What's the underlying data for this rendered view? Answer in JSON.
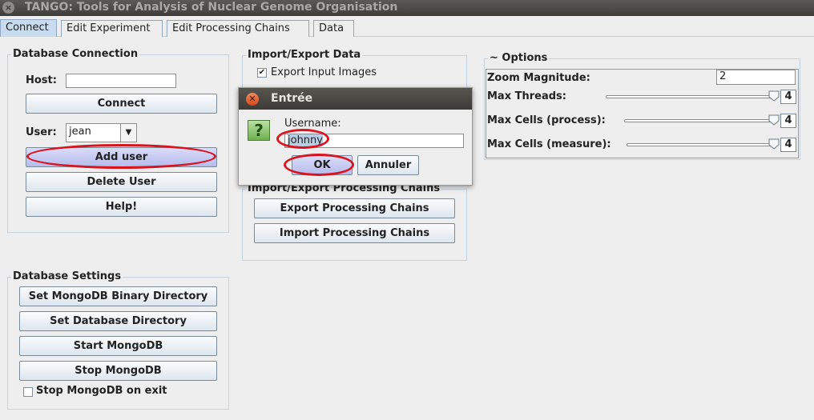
{
  "window": {
    "title": "TANGO: Tools for Analysis of Nuclear Genome Organisation",
    "close_glyph": "×"
  },
  "tabs": [
    {
      "label": "Connect",
      "active": true
    },
    {
      "label": "Edit Experiment"
    },
    {
      "label": "Edit Processing Chains"
    },
    {
      "label": "Data"
    }
  ],
  "db_connection": {
    "title": "Database Connection",
    "host_label": "Host:",
    "host_value": "",
    "connect_label": "Connect",
    "user_label": "User:",
    "user_value": "jean",
    "add_user_label": "Add user",
    "delete_user_label": "Delete User",
    "help_label": "Help!"
  },
  "import_export": {
    "title": "Import/Export Data",
    "export_images_label": "Export Input Images",
    "export_images_checked": true
  },
  "processing_chains": {
    "title": "Import/Export Processing Chains",
    "export_label": "Export Processing Chains",
    "import_label": "Import Processing Chains"
  },
  "db_settings": {
    "title": "Database Settings",
    "binary_dir_label": "Set MongoDB Binary Directory",
    "db_dir_label": "Set Database Directory",
    "start_label": "Start MongoDB",
    "stop_label": "Stop MongoDB",
    "stop_on_exit_label": "Stop MongoDB on exit",
    "stop_on_exit_checked": false
  },
  "options": {
    "title": "~ Options",
    "zoom_label": "Zoom Magnitude:",
    "zoom_value": "2",
    "threads_label": "Max Threads:",
    "threads_value": "4",
    "cells_process_label": "Max Cells (process):",
    "cells_process_value": "4",
    "cells_measure_label": "Max Cells (measure):",
    "cells_measure_value": "4"
  },
  "dialog": {
    "title": "Entrée",
    "icon_glyph": "?",
    "prompt_label": "Username:",
    "input_value": "johnny",
    "ok_label": "OK",
    "cancel_label": "Annuler"
  },
  "colors": {
    "highlight": "#d8141f",
    "selection": "#c8dcf0",
    "add_user_button": "#c4c8f0"
  }
}
